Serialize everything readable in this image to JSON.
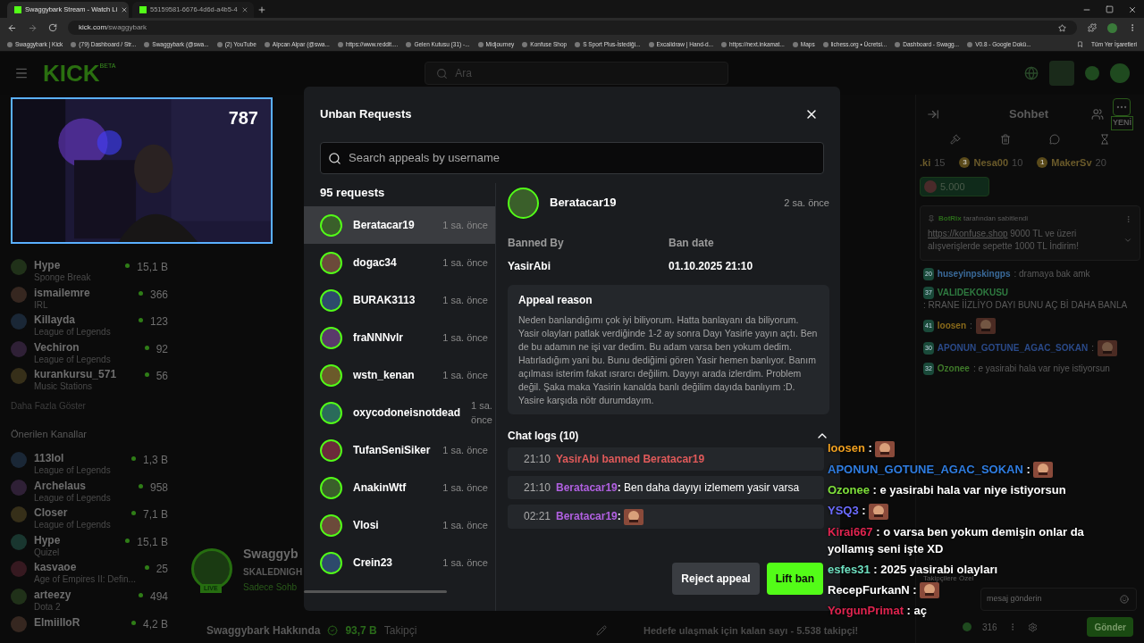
{
  "browser": {
    "tabs": [
      {
        "title": "Swaggybark Stream - Watch Li",
        "selected": true
      },
      {
        "title": "55159581-6676-4d6d-a4b5-4",
        "selected": false
      }
    ],
    "url_host": "kick.com",
    "url_path": "/swaggybark",
    "bookmarks": [
      "Swaggybark | Kick",
      "(79) Dashboard / Str...",
      "Swaggybark (@swa...",
      "(2) YouTube",
      "Alpcan Alpar (@swa...",
      "https://www.reddit....",
      "Gelen Kutusu (31) -...",
      "Midjourney",
      "Konfuse Shop",
      "S Sport Plus-İstediği...",
      "Excalidraw | Hand-d...",
      "https://next.inkamat...",
      "Maps",
      "lichess.org • Ücretsi...",
      "Dashboard - Swagg...",
      "V0.8 - Google Dokü..."
    ],
    "all_bookmarks": "Tüm Yer İşaretleri"
  },
  "nav": {
    "logo": "KICK",
    "logo_tag": "BETA",
    "search_placeholder": "Ara"
  },
  "webcam": {
    "counter": "787"
  },
  "sidebar": {
    "followed": [
      {
        "name": "Hype",
        "category": "Sponge Break",
        "viewers": "15,1 B"
      },
      {
        "name": "ismailemre",
        "category": "IRL",
        "viewers": "366"
      },
      {
        "name": "Killayda",
        "category": "League of Legends",
        "viewers": "123"
      },
      {
        "name": "Vechiron",
        "category": "League of Legends",
        "viewers": "92"
      },
      {
        "name": "kurankursu_571",
        "category": "Music Stations",
        "viewers": "56"
      }
    ],
    "show_more": "Daha Fazla Göster",
    "recommended_title": "Önerilen Kanallar",
    "recommended": [
      {
        "name": "113lol",
        "category": "League of Legends",
        "viewers": "1,3 B"
      },
      {
        "name": "Archelaus",
        "category": "League of Legends",
        "viewers": "958"
      },
      {
        "name": "Closer",
        "category": "League of Legends",
        "viewers": "7,1 B"
      },
      {
        "name": "Hype",
        "category": "Quizel",
        "viewers": "15,1 B"
      },
      {
        "name": "kasvaoe",
        "category": "Age of Empires II: Defin...",
        "viewers": "25"
      },
      {
        "name": "arteezy",
        "category": "Dota 2",
        "viewers": "494"
      },
      {
        "name": "ElmiilloR",
        "viewers": "4,2 B"
      }
    ]
  },
  "stream": {
    "title": "Swaggyb",
    "subtitle": "SKALEDNIGH",
    "category": "Sadece Sohb",
    "live_badge": "LIVE",
    "about": "Swaggybark Hakkında",
    "followers": "93,7 B",
    "followers_label": "Takipçi",
    "goal": "Hedefe ulaşmak için kalan sayı - 5.538 takipçi!"
  },
  "chat": {
    "title": "Sohbet",
    "new_badge": "YENİ",
    "separator": ": ",
    "leaders": [
      {
        "name": ".ki",
        "score": "15"
      },
      {
        "rank": "3",
        "name": "Nesa00",
        "score": "10"
      },
      {
        "rank": "1",
        "name": "MakerSv",
        "score": "20"
      }
    ],
    "gift": "5.000",
    "pinned": {
      "by": "BotRix",
      "by_suffix": "tarafından sabitlendi",
      "link": "https://konfuse.shop",
      "text": "9000 TL ve üzeri alışverişlerde sepette 1000 TL İndirim!"
    },
    "messages": [
      {
        "kind": "text",
        "badge": "20",
        "user": "huseyinpskingps",
        "color": "#3a6a9a",
        "text": "dramaya bak amk"
      },
      {
        "kind": "text",
        "badge": "37",
        "user": "VALIDEKOKUSU",
        "color": "#2f7a40",
        "text": "RRANE İİZLİYO DAYI BUNU AÇ Bİ DAHA BANLA"
      },
      {
        "kind": "emote",
        "badge": "41",
        "user": "loosen",
        "color": "#8a6a1a"
      },
      {
        "kind": "emote",
        "badge": "30",
        "user": "APONUN_GOTUNE_AGAC_SOKAN",
        "color": "#2a4a8a"
      },
      {
        "kind": "text",
        "badge": "32",
        "user": "Ozonee",
        "color": "#3f7a2a",
        "text": "e yasirabi hala var niye istiyorsun"
      }
    ],
    "followers_only": "Takipçilere Özel",
    "input_placeholder": "mesaj gönderin",
    "points": "316",
    "send": "Gönder"
  },
  "modal": {
    "title": "Unban Requests",
    "search_placeholder": "Search appeals by username",
    "count": "95 requests",
    "requests": [
      {
        "name": "Beratacar19",
        "time": "1 sa. önce",
        "selected": true
      },
      {
        "name": "dogac34",
        "time": "1 sa. önce",
        "selected": false
      },
      {
        "name": "BURAK3113",
        "time": "1 sa. önce",
        "selected": false
      },
      {
        "name": "fraNNNvlr",
        "time": "1 sa. önce",
        "selected": false
      },
      {
        "name": "wstn_kenan",
        "time": "1 sa. önce",
        "selected": false
      },
      {
        "name": "oxycodoneisnotdead",
        "time": "1 sa. önce",
        "selected": false
      },
      {
        "name": "TufanSeniSiker",
        "time": "1 sa. önce",
        "selected": false
      },
      {
        "name": "AnakinWtf",
        "time": "1 sa. önce",
        "selected": false
      },
      {
        "name": "Vlosi",
        "time": "1 sa. önce",
        "selected": false
      },
      {
        "name": "Crein23",
        "time": "1 sa. önce",
        "selected": false
      }
    ],
    "detail": {
      "name": "Beratacar19",
      "time": "2 sa. önce",
      "banned_by_label": "Banned By",
      "banned_by": "YasirAbi",
      "ban_date_label": "Ban date",
      "ban_date": "01.10.2025 21:10",
      "reason_title": "Appeal reason",
      "reason": "Neden banlandığımı çok iyi biliyorum. Hatta banlayanı da biliyorum. Yasir olayları patlak verdiğinde 1-2 ay sonra Dayı Yasirle yayın açtı. Ben de bu adamın ne işi var dedim. Bu adam varsa ben yokum dedim. Hatırladığım yani bu. Bunu dediğimi gören Yasir hemen banlıyor. Banım açılması isterim fakat ısrarcı değilim. Dayıyı arada izlerdim. Problem değil. Şaka maka Yasirin kanalda banlı değilim dayıda banlıyım :D. Yasire karşıda nötr durumdayım.",
      "logs_title": "Chat logs (10)",
      "logs_expanded": true,
      "separator": ": ",
      "logs": [
        {
          "kind": "system",
          "time": "21:10",
          "text": "YasirAbi banned Beratacar19"
        },
        {
          "kind": "message",
          "time": "21:10",
          "user": "Beratacar19",
          "text": "Ben daha dayıyı izlemem yasir varsa"
        },
        {
          "kind": "emote",
          "time": "02:21",
          "user": "Beratacar19"
        }
      ]
    },
    "reject": "Reject appeal",
    "lift": "Lift ban"
  },
  "overlay_chat": {
    "separator": " : ",
    "lines": [
      {
        "kind": "emote",
        "user": "loosen",
        "color": "#f0a020"
      },
      {
        "kind": "emote",
        "user": "APONUN_GOTUNE_AGAC_SOKAN",
        "color": "#2f7de1"
      },
      {
        "kind": "text",
        "user": "Ozonee",
        "color": "#7ee03a",
        "text": "e yasirabi hala var niye istiyorsun"
      },
      {
        "kind": "emote",
        "user": "YSQ3",
        "color": "#6b6bff"
      },
      {
        "kind": "text",
        "user": "Kirai667",
        "color": "#e0244f",
        "text": "o varsa ben yokum demişin onlar da yollamış seni işte XD"
      },
      {
        "kind": "text",
        "user": "esfes31",
        "color": "#6ee0c0",
        "text": "2025 yasirabi olayları"
      },
      {
        "kind": "emote",
        "user": "RecepFurkanN",
        "color": "#ffffff"
      },
      {
        "kind": "text",
        "user": "YorgunPrimat",
        "color": "#e0244f",
        "text": "aç"
      }
    ]
  }
}
